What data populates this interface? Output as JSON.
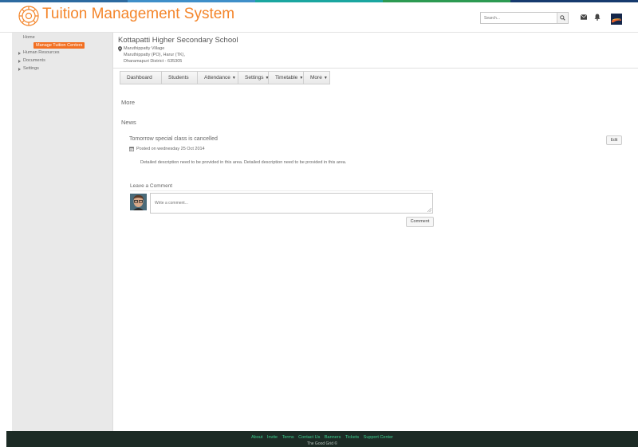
{
  "colors": {
    "brand_orange": "#f4852a",
    "active_orange": "#f26f21",
    "footer_bg": "#1c2b25",
    "footer_link": "#3ecf8e",
    "top_strip": [
      "#2c6aa0",
      "#3f8fc9",
      "#1aa6a0",
      "#2c9a52",
      "#163a6e"
    ]
  },
  "header": {
    "logo_icon": "gear-sun-logo",
    "title": "Tuition Management System",
    "search_placeholder": "Search...",
    "icons": [
      "search-icon",
      "envelope-icon",
      "bell-icon",
      "avatar"
    ]
  },
  "sidebar": {
    "home": "Home",
    "active": "Manage Tuition  Centers",
    "items": [
      "Human Resources",
      "Documents",
      "Settings"
    ]
  },
  "school": {
    "name": "Kottapatti Higher Secondary School",
    "address1": "Maruthippatty Village",
    "address2": "Maruthippatty (PO), Harur (TK),",
    "address3": "Dharamapuri District - 635305"
  },
  "nav": {
    "dashboard": "Dashboard",
    "students": "Students",
    "attendance": "Attendance",
    "settings": "Settings",
    "timetable": "Timetable",
    "more": "More"
  },
  "sections": {
    "more": "More",
    "news": "News"
  },
  "news_item": {
    "title": "Tomorrow special class is cancelled",
    "edit_label": "Edit",
    "posted": "Posted on wednesday 25 Oct 2014",
    "description": "Detailed description need to  be provided in this area. Detailed description need to  be provided in this area."
  },
  "comment": {
    "heading": "Leave a Comment",
    "placeholder": "Write a comment...",
    "button": "Comment"
  },
  "footer": {
    "links": [
      "About",
      "Invite",
      "Terms",
      "Contact Us",
      "Banners",
      "Tickets",
      "Support Center"
    ],
    "copyright": "The Good Grid ©"
  }
}
